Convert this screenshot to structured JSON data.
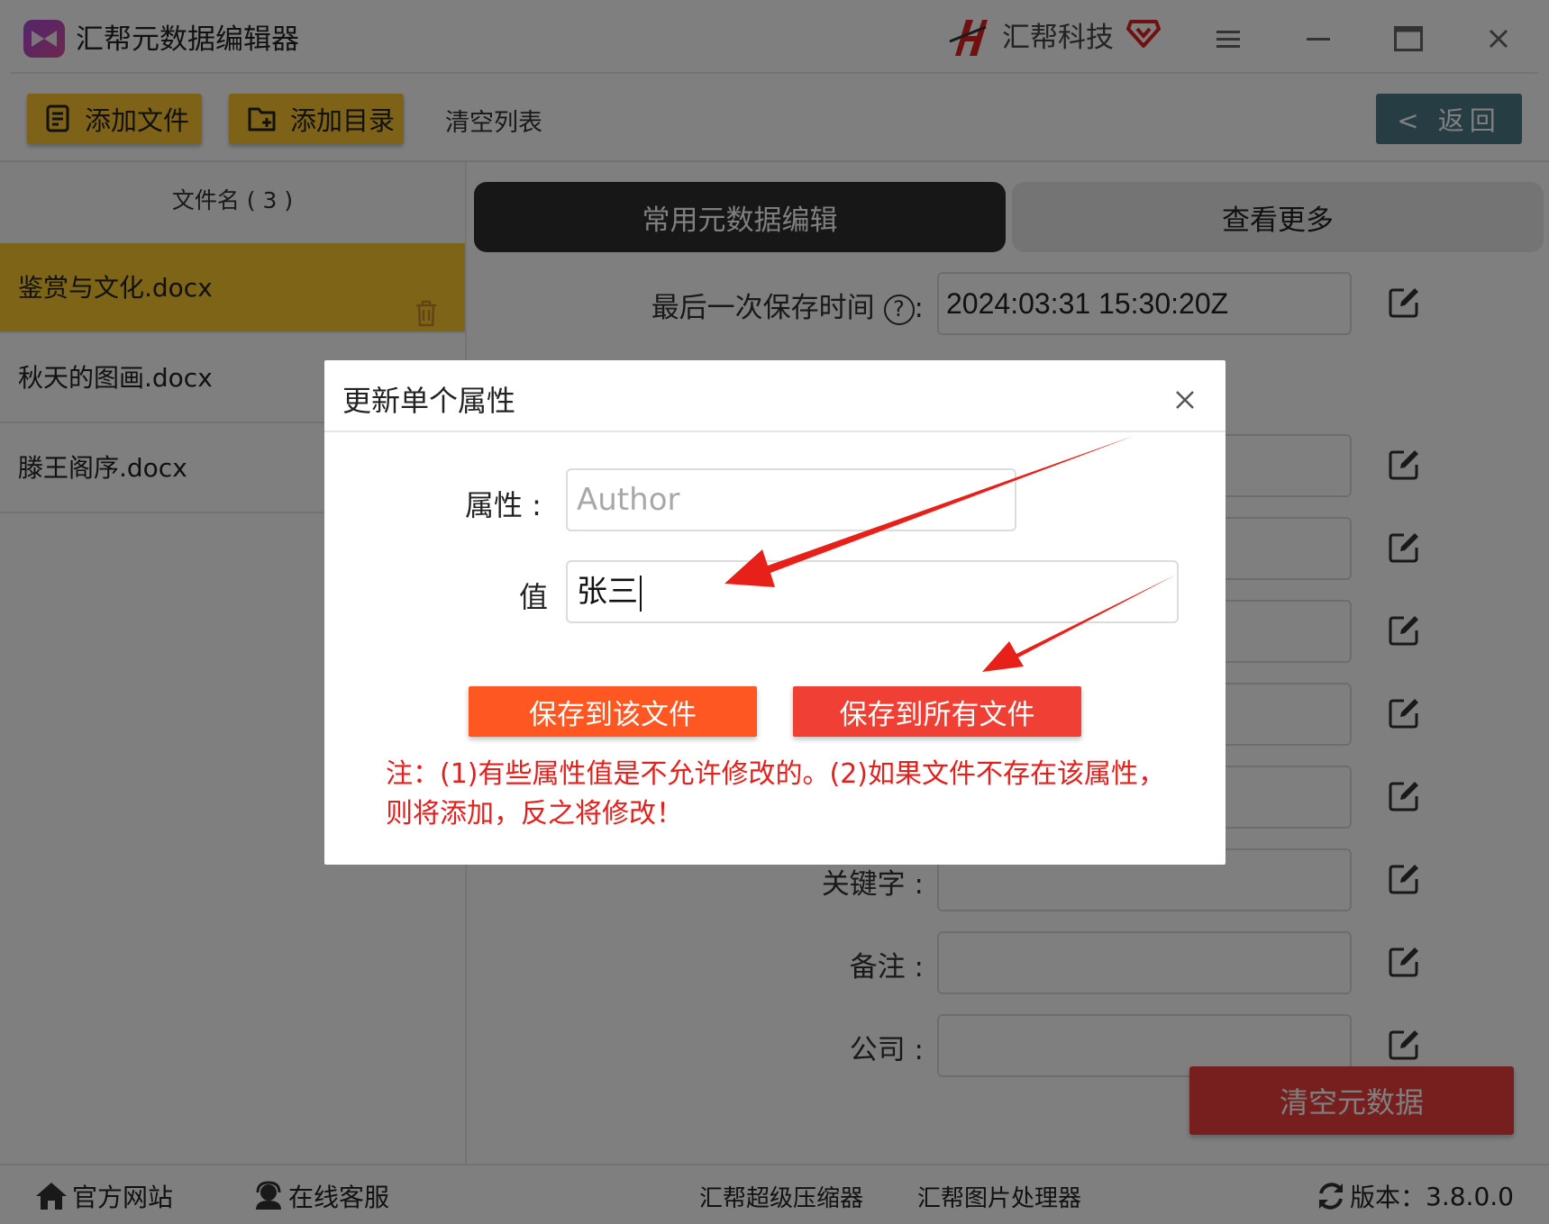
{
  "app": {
    "title": "汇帮元数据编辑器",
    "brand": "汇帮科技"
  },
  "toolbar": {
    "add_file": "添加文件",
    "add_folder": "添加目录",
    "clear_list": "清空列表",
    "back": "< 返回"
  },
  "files": {
    "header": "文件名 ( 3 )",
    "items": [
      {
        "name": "鉴赏与文化.docx",
        "selected": true
      },
      {
        "name": "秋天的图画.docx",
        "selected": false
      },
      {
        "name": "滕王阁序.docx",
        "selected": false
      }
    ]
  },
  "tabs": {
    "common": "常用元数据编辑",
    "more": "查看更多"
  },
  "fields": {
    "last_saved_label": "最后一次保存时间",
    "last_saved_value": "2024:03:31 15:30:20Z",
    "keywords_label": "关键字 :",
    "remarks_label": "备注 :",
    "company_label": "公司 :"
  },
  "clear_metadata": "清空元数据",
  "dialog": {
    "title": "更新单个属性",
    "attr_label": "属性 :",
    "attr_placeholder": "Author",
    "value_label": "值",
    "value": "张三",
    "save_this": "保存到该文件",
    "save_all": "保存到所有文件",
    "note": "注：(1)有些属性值是不允许修改的。(2)如果文件不存在该属性，则将添加，反之将修改！"
  },
  "footer": {
    "website": "官方网站",
    "support": "在线客服",
    "compressor": "汇帮超级压缩器",
    "image_tool": "汇帮图片处理器",
    "version_label": "版本：",
    "version": "3.8.0.0"
  },
  "colors": {
    "accent_yellow": "#fbc52e",
    "back_button": "#4e7a88",
    "danger_red": "#ef3e3c",
    "save_this_orange": "#ff5722",
    "save_all_red": "#f03f35",
    "note_red": "#e4201d",
    "arrow_red": "#e8201a"
  },
  "icons": [
    "app-logo-icon",
    "brand-logo-icon",
    "vip-icon",
    "menu-icon",
    "minimize-icon",
    "maximize-icon",
    "close-icon",
    "add-file-icon",
    "add-folder-icon",
    "trash-icon",
    "help-icon",
    "edit-icon",
    "home-icon",
    "support-icon",
    "refresh-icon"
  ]
}
